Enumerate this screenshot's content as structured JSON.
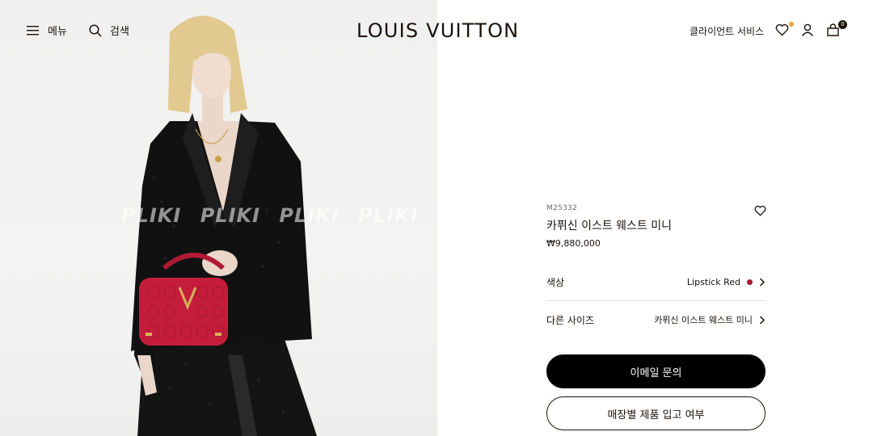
{
  "header": {
    "menu_label": "메뉴",
    "search_label": "검색",
    "logo": "LOUIS VUITTON",
    "client_service": "클라이언트 서비스",
    "bag_count": "0"
  },
  "image": {
    "watermark": "PLIKI PLIKI PLIKI PLIKI PLI"
  },
  "product": {
    "sku": "M25332",
    "name": "카퓌신 이스트 웨스트 미니",
    "price": "₩9,880,000",
    "color_label": "색상",
    "color_value": "Lipstick Red",
    "color_hex": "#a8182f",
    "size_label": "다른 사이즈",
    "size_value": "카퓌신 이스트 웨스트 미니"
  },
  "actions": {
    "email_inquiry": "이메일 문의",
    "store_availability": "매장별 제품 입고 여부"
  },
  "icons": [
    "menu-icon",
    "search-icon",
    "heart-icon",
    "account-icon",
    "bag-icon",
    "chevron-right-icon"
  ]
}
